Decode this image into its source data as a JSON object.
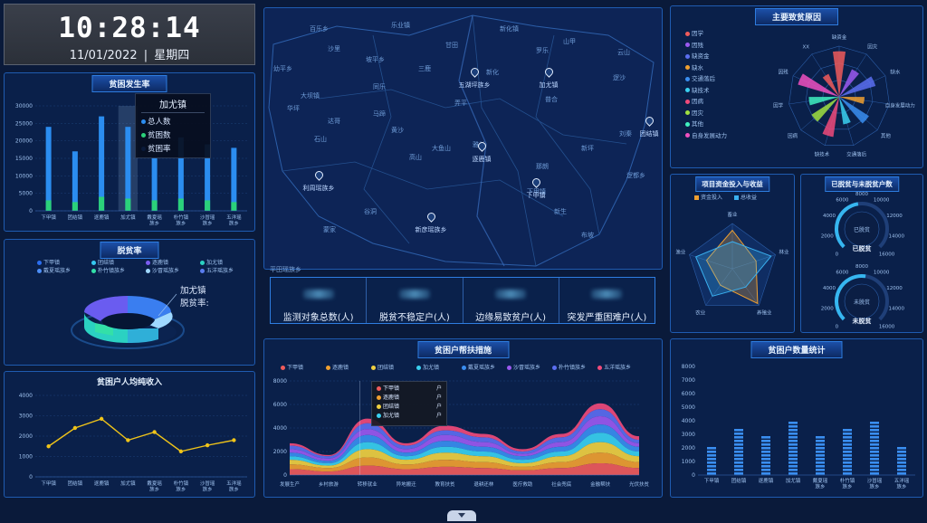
{
  "clock": {
    "time": "10:28:14",
    "date": "11/01/2022",
    "weekday": "星期四"
  },
  "towns": [
    "下甲镇",
    "团结镇",
    "逐鹿镇",
    "加尤镇",
    "戴夏瑶族乡",
    "朴竹镇族乡",
    "沙冒瑶族乡",
    "五洋瑶族乡"
  ],
  "towns_two_line": [
    [
      "下甲镇"
    ],
    [
      "团结镇"
    ],
    [
      "逐鹿镇"
    ],
    [
      "加尤镇"
    ],
    [
      "戴夏瑶",
      "族乡"
    ],
    [
      "朴竹镇",
      "族乡"
    ],
    [
      "沙冒瑶",
      "族乡"
    ],
    [
      "五洋瑶",
      "族乡"
    ]
  ],
  "poverty_rate": {
    "title": "贫困发生率",
    "tooltip": {
      "title": "加尤镇",
      "items": [
        "总人数",
        "贫困数",
        "贫困率"
      ]
    },
    "chart_data": {
      "type": "bar",
      "categories": [
        "下甲镇",
        "团结镇",
        "逐鹿镇",
        "加尤镇",
        "戴夏瑶族乡",
        "朴竹镇族乡",
        "沙冒瑶族乡",
        "五洋瑶族乡"
      ],
      "ylim": [
        0,
        30000
      ],
      "yticks": [
        0,
        5000,
        10000,
        15000,
        20000,
        25000,
        30000
      ],
      "series": [
        {
          "values": [
            24000,
            17000,
            27000,
            24000,
            15000,
            21000,
            19000,
            18000
          ]
        },
        {
          "values": [
            3000,
            2500,
            4000,
            3500,
            3000,
            3500,
            3000,
            2500
          ]
        }
      ],
      "colors": [
        "#2b8df0",
        "#2bd17a"
      ]
    }
  },
  "poverty_relief": {
    "title": "脱贫率",
    "legend": [
      {
        "label": "下甲镇",
        "color": "#2b6ef0"
      },
      {
        "label": "团结镇",
        "color": "#36c8f0"
      },
      {
        "label": "逐鹿镇",
        "color": "#7b5cf0"
      },
      {
        "label": "加尤镇",
        "color": "#2bd1c2"
      },
      {
        "label": "戴夏瑶族乡",
        "color": "#4d8ef7"
      },
      {
        "label": "朴竹镇族乡",
        "color": "#33e0a8"
      },
      {
        "label": "沙冒瑶族乡",
        "color": "#a0d8ff"
      },
      {
        "label": "五洋瑶族乡",
        "color": "#5a7df0"
      }
    ],
    "callout_town": "加尤镇",
    "callout_label": "脱贫率:"
  },
  "income": {
    "title": "贫困户人均纯收入",
    "chart_data": {
      "type": "line",
      "categories": [
        "下甲镇",
        "团结镇",
        "逐鹿镇",
        "加尤镇",
        "戴夏瑶族乡",
        "朴竹镇族乡",
        "沙冒瑶族乡",
        "五洋瑶族乡"
      ],
      "ylim": [
        0,
        4000
      ],
      "yticks": [
        0,
        1000,
        2000,
        3000,
        4000
      ],
      "values": [
        1500,
        2400,
        2850,
        1800,
        2200,
        1250,
        1550,
        1800
      ],
      "color": "#f0c419"
    }
  },
  "map": {
    "labels": [
      "百乐乡",
      "乐业镇",
      "新化镇",
      "山甲",
      "沙里",
      "甘田",
      "罗乐",
      "云山",
      "幼平乡",
      "三鹿",
      "新化",
      "坡平乡",
      "逻沙",
      "普合",
      "大坝镇",
      "同乐",
      "弄平",
      "华坪",
      "马蹄",
      "达哥",
      "石山",
      "黄沙",
      "雅长",
      "高山",
      "新坪",
      "刘秦",
      "蒙家",
      "谷洞",
      "大鱼山",
      "那朗",
      "新生",
      "逻都乡",
      "布坡",
      "下甲镇"
    ],
    "pins": [
      "五湖坪族乡",
      "加尤镇",
      "逐鹿镇",
      "团结镇",
      "利周瑶族乡",
      "下甲镇",
      "新彦瑶族乡"
    ],
    "bottom_label": "平田瑶族乡",
    "stats": [
      {
        "label": "监测对象总数(人)"
      },
      {
        "label": "脱贫不稳定户(人)"
      },
      {
        "label": "边缘易致贫户(人)"
      },
      {
        "label": "突发严重困难户(人)"
      }
    ]
  },
  "causes": {
    "title": "主要致贫原因",
    "legend": [
      {
        "label": "因学",
        "color": "#f05b5b"
      },
      {
        "label": "因残",
        "color": "#9b59f0"
      },
      {
        "label": "缺资金",
        "color": "#5b6ef0"
      },
      {
        "label": "缺水",
        "color": "#f0a030"
      },
      {
        "label": "交通落后",
        "color": "#3a8ef0"
      },
      {
        "label": "缺技术",
        "color": "#3ad0f0"
      },
      {
        "label": "因病",
        "color": "#f04a7a"
      },
      {
        "label": "因灾",
        "color": "#a0e040"
      },
      {
        "label": "其他",
        "color": "#40f0c0"
      },
      {
        "label": "自身发展动力",
        "color": "#f050c0"
      }
    ],
    "radar_labels": [
      "缺资金",
      "因灾",
      "缺水",
      "自身发展动力",
      "其他",
      "交通落后",
      "缺技术",
      "因病",
      "因学",
      "因残",
      "XX"
    ]
  },
  "investment": {
    "title": "项目资金投入与收益",
    "legend": [
      {
        "label": "资金投入",
        "color": "#f0a030"
      },
      {
        "label": "总收益",
        "color": "#3ab0f0"
      }
    ],
    "axes": [
      "畜业",
      "林业",
      "养殖业",
      "农业",
      "渔业"
    ]
  },
  "gauges": {
    "title": "已脱贫与未脱贫户数",
    "items": [
      {
        "label": "已脱贫",
        "value": 7500,
        "scale": [
          "2000",
          "4000",
          "6000",
          "8000",
          "10000",
          "12000",
          "14000",
          "16000",
          "0"
        ]
      },
      {
        "label": "未脱贫",
        "value": 8500,
        "scale": [
          "2000",
          "4000",
          "6000",
          "8000",
          "10000",
          "12000",
          "14000",
          "16000",
          "0"
        ]
      }
    ]
  },
  "measures": {
    "title": "贫困户帮扶措施",
    "legend": [
      {
        "label": "下甲镇",
        "color": "#f05b5b"
      },
      {
        "label": "逐鹿镇",
        "color": "#f0a030"
      },
      {
        "label": "团结镇",
        "color": "#f0d040"
      },
      {
        "label": "加尤镇",
        "color": "#3ad0f0"
      },
      {
        "label": "戴夏瑶族乡",
        "color": "#3a8ef0"
      },
      {
        "label": "沙冒瑶族乡",
        "color": "#9b59f0"
      },
      {
        "label": "朴竹镇族乡",
        "color": "#5b6ef0"
      },
      {
        "label": "五洋瑶族乡",
        "color": "#f04a7a"
      }
    ],
    "tooltip_items": [
      {
        "label": "下甲镇",
        "suffix": "户",
        "color": "#f05b5b"
      },
      {
        "label": "逐鹿镇",
        "suffix": "户",
        "color": "#f0a030"
      },
      {
        "label": "团结镇",
        "suffix": "户",
        "color": "#f0d040"
      },
      {
        "label": "加尤镇",
        "suffix": "户",
        "color": "#3ad0f0"
      }
    ],
    "chart_data": {
      "type": "area",
      "categories": [
        "发展生产",
        "乡村旅游",
        "转移就业",
        "异地搬迁",
        "教育扶贫",
        "退耕还林",
        "医疗救助",
        "社会兜底",
        "金融帮扶",
        "光伏扶贫"
      ],
      "ylim": [
        0,
        8000
      ],
      "yticks": [
        0,
        2000,
        4000,
        6000,
        8000
      ],
      "series": [
        {
          "name": "下甲镇",
          "values": [
            500,
            300,
            800,
            500,
            700,
            600,
            400,
            600,
            1000,
            600
          ]
        },
        {
          "name": "逐鹿镇",
          "values": [
            400,
            300,
            700,
            400,
            600,
            500,
            300,
            500,
            900,
            500
          ]
        },
        {
          "name": "团结镇",
          "values": [
            400,
            200,
            700,
            400,
            600,
            500,
            300,
            500,
            900,
            500
          ]
        },
        {
          "name": "加尤镇",
          "values": [
            300,
            200,
            600,
            300,
            500,
            400,
            300,
            400,
            800,
            400
          ]
        },
        {
          "name": "戴夏瑶族乡",
          "values": [
            300,
            200,
            600,
            300,
            500,
            400,
            300,
            400,
            700,
            400
          ]
        },
        {
          "name": "沙冒瑶族乡",
          "values": [
            300,
            200,
            500,
            300,
            500,
            400,
            200,
            400,
            700,
            300
          ]
        },
        {
          "name": "朴竹镇族乡",
          "values": [
            300,
            200,
            500,
            300,
            400,
            400,
            200,
            400,
            600,
            300
          ]
        },
        {
          "name": "五洋瑶族乡",
          "values": [
            200,
            100,
            400,
            200,
            400,
            300,
            200,
            300,
            500,
            300
          ]
        }
      ]
    }
  },
  "households": {
    "title": "贫困户数量统计",
    "chart_data": {
      "type": "bar",
      "categories": [
        "下甲镇",
        "团结镇",
        "逐鹿镇",
        "加尤镇",
        "戴夏瑶族乡",
        "朴竹镇族乡",
        "沙冒瑶族乡",
        "五洋瑶族乡"
      ],
      "ylim": [
        0,
        8000
      ],
      "yticks": [
        0,
        1000,
        2000,
        3000,
        4000,
        5000,
        6000,
        7000,
        8000
      ],
      "values": [
        2200,
        3500,
        2950,
        4000,
        2950,
        3500,
        4000,
        2200
      ],
      "color": "#3a8ef0"
    }
  }
}
